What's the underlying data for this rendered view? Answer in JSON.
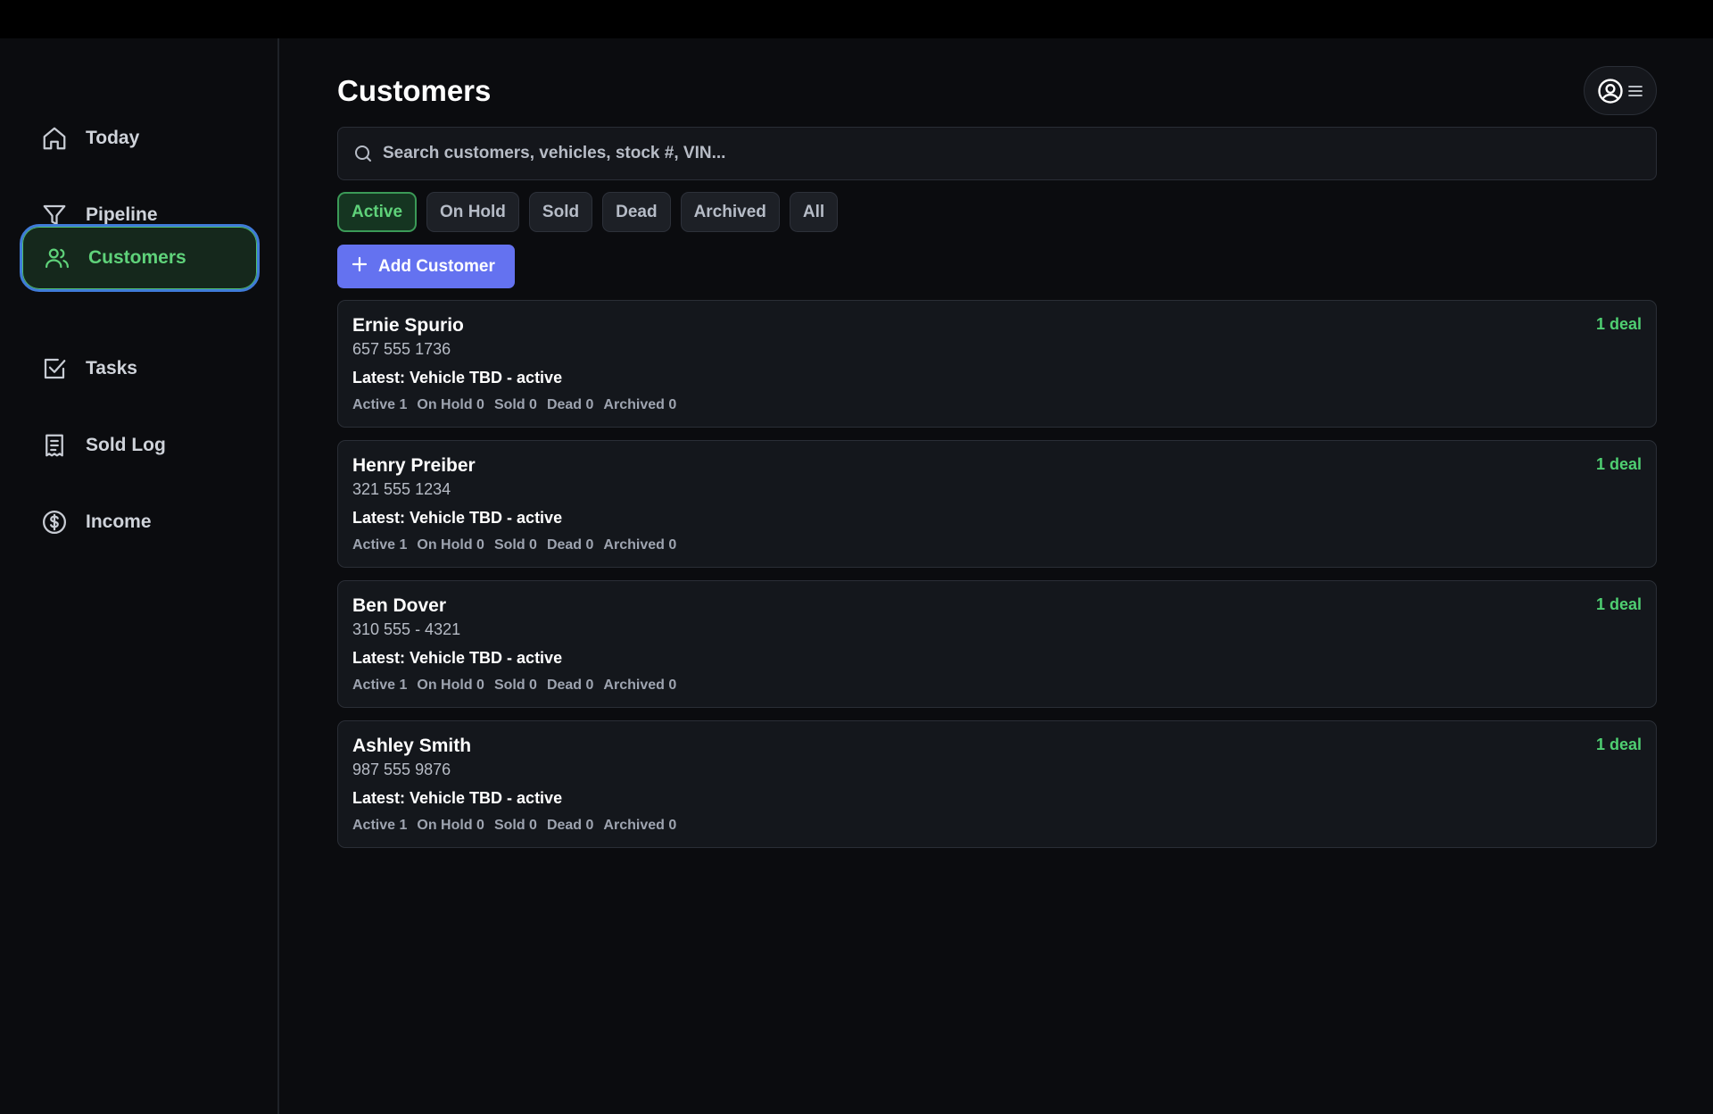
{
  "sidebar": {
    "items": [
      {
        "label": "Today",
        "icon": "home-icon"
      },
      {
        "label": "Pipeline",
        "icon": "funnel-icon"
      },
      {
        "label": "Customers",
        "icon": "users-icon",
        "active": true
      },
      {
        "label": "Tasks",
        "icon": "checkbox-icon"
      },
      {
        "label": "Sold Log",
        "icon": "receipt-icon"
      },
      {
        "label": "Income",
        "icon": "dollar-icon"
      }
    ]
  },
  "header": {
    "title": "Customers",
    "account_icon": "account-menu-icon"
  },
  "search": {
    "placeholder": "Search customers, vehicles, stock #, VIN...",
    "value": ""
  },
  "filters": [
    "Active",
    "On Hold",
    "Sold",
    "Dead",
    "Archived",
    "All"
  ],
  "active_filter": "Active",
  "add_button": {
    "label": "Add Customer"
  },
  "customers": [
    {
      "name": "Ernie Spurio",
      "phone": "657 555 1736",
      "latest": "Latest: Vehicle TBD - active",
      "deals": "1 deal",
      "stats": [
        "Active 1",
        "On Hold 0",
        "Sold 0",
        "Dead 0",
        "Archived 0"
      ]
    },
    {
      "name": "Henry Preiber",
      "phone": "321 555 1234",
      "latest": "Latest: Vehicle TBD - active",
      "deals": "1 deal",
      "stats": [
        "Active 1",
        "On Hold 0",
        "Sold 0",
        "Dead 0",
        "Archived 0"
      ]
    },
    {
      "name": "Ben Dover",
      "phone": "310 555 - 4321",
      "latest": "Latest: Vehicle TBD - active",
      "deals": "1 deal",
      "stats": [
        "Active 1",
        "On Hold 0",
        "Sold 0",
        "Dead 0",
        "Archived 0"
      ]
    },
    {
      "name": "Ashley Smith",
      "phone": "987 555 9876",
      "latest": "Latest: Vehicle TBD - active",
      "deals": "1 deal",
      "stats": [
        "Active 1",
        "On Hold 0",
        "Sold 0",
        "Dead 0",
        "Archived 0"
      ]
    }
  ],
  "colors": {
    "accent_green": "#5fd27a",
    "primary_button": "#6472f0",
    "active_border": "#3f7bd8"
  }
}
